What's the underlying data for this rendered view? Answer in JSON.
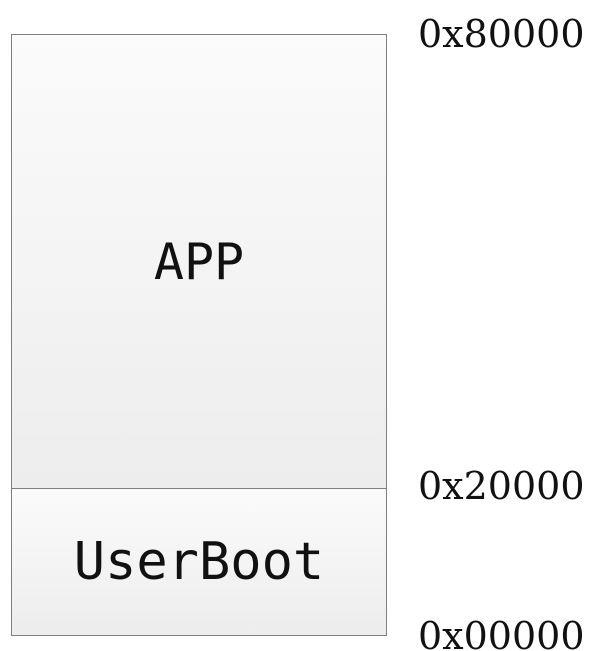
{
  "memory_map": {
    "regions": [
      {
        "label": "APP"
      },
      {
        "label": "UserBoot"
      }
    ],
    "addresses": {
      "top": "0x80000",
      "boundary": "0x20000",
      "bottom": "0x00000"
    }
  }
}
